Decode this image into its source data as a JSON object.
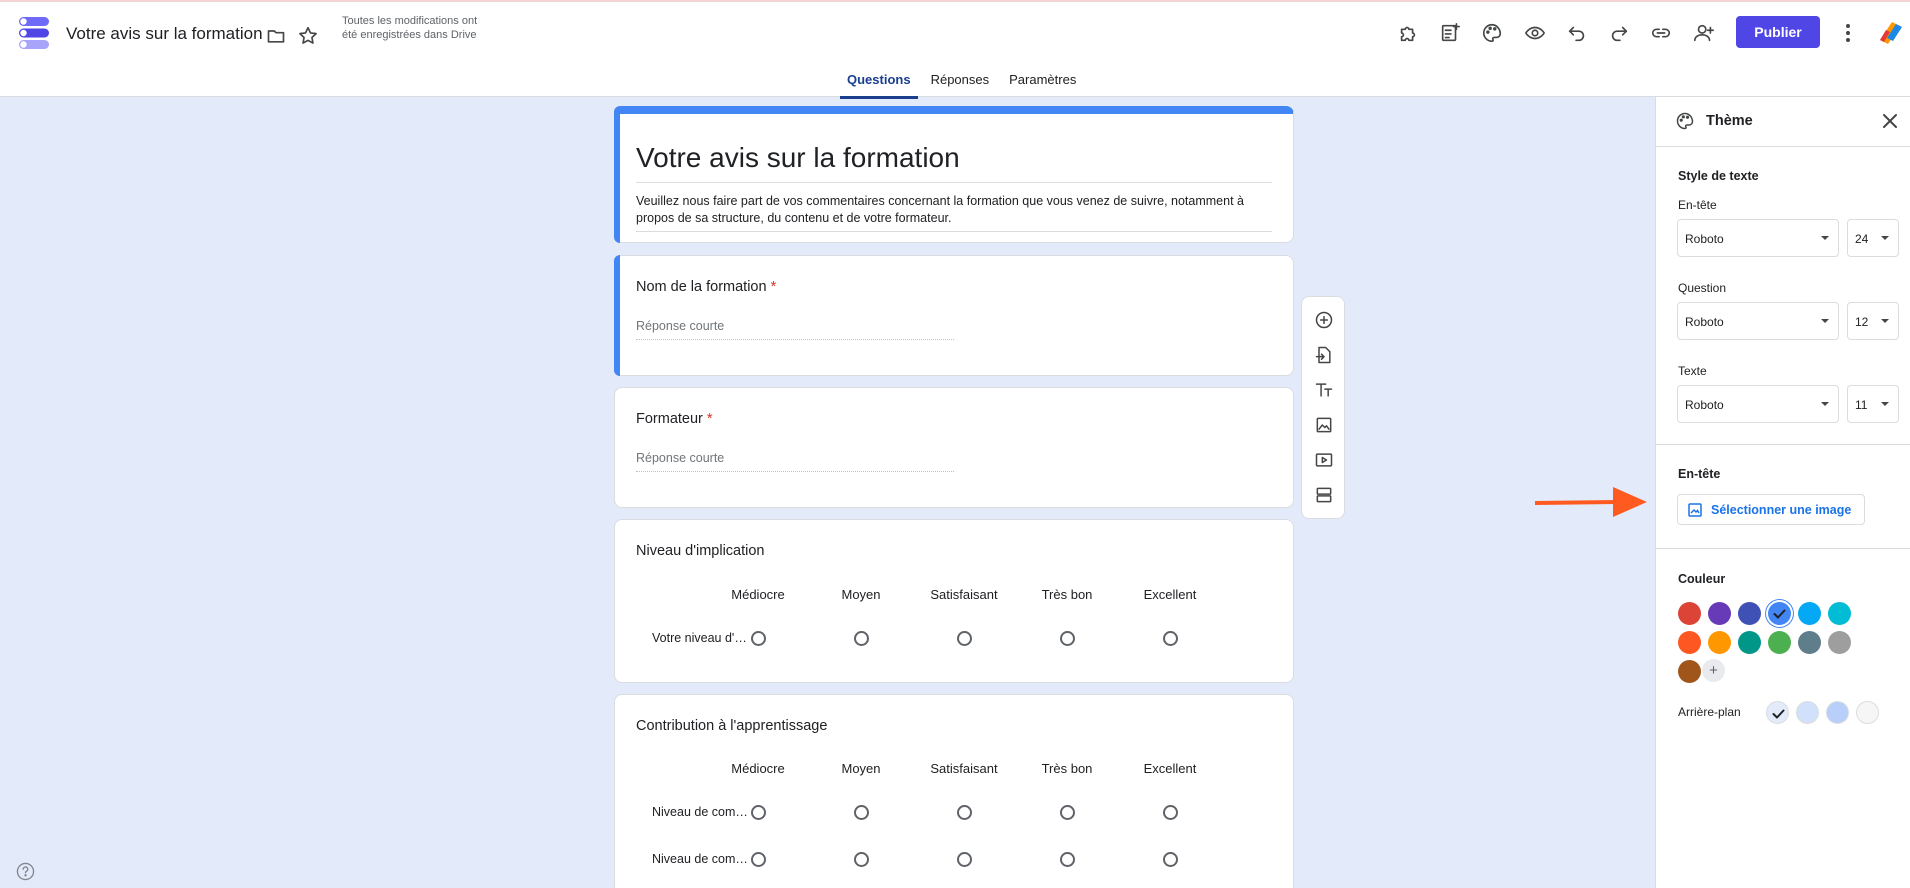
{
  "header": {
    "doc_title": "Votre avis sur la formation",
    "save_status": "Toutes les modifications ont été enregistrées dans Drive",
    "publish_label": "Publier",
    "tools": [
      "puzzle-icon",
      "add-sheet-icon",
      "palette-icon",
      "eye-icon",
      "undo-icon",
      "redo-icon",
      "link-icon",
      "add-person-icon"
    ]
  },
  "tabs": [
    {
      "label": "Questions",
      "active": true
    },
    {
      "label": "Réponses",
      "active": false
    },
    {
      "label": "Paramètres",
      "active": false
    }
  ],
  "form": {
    "title": "Votre avis sur la formation",
    "description": "Veuillez nous faire part de vos commentaires concernant la formation que vous venez de suivre, notamment à propos de sa structure, du contenu et de votre formateur."
  },
  "questions": [
    {
      "title": "Nom de la formation",
      "required": "*",
      "placeholder": "Réponse courte"
    },
    {
      "title": "Formateur",
      "required": "*",
      "placeholder": "Réponse courte"
    },
    {
      "title": "Niveau d'implication",
      "columns": [
        "Médiocre",
        "Moyen",
        "Satisfaisant",
        "Très bon",
        "Excellent"
      ],
      "rows": [
        "Votre niveau d'implication"
      ]
    },
    {
      "title": "Contribution à l'apprentissage",
      "columns": [
        "Médiocre",
        "Moyen",
        "Satisfaisant",
        "Très bon",
        "Excellent"
      ],
      "rows": [
        "Niveau de compétence avant",
        "Niveau de compétence après"
      ]
    }
  ],
  "side_toolbar": [
    "add-question-icon",
    "import-questions-icon",
    "title-text-icon",
    "image-icon",
    "video-icon",
    "section-icon"
  ],
  "theme_panel": {
    "title": "Thème",
    "text_style_label": "Style de texte",
    "header_label": "En-tête",
    "header_font": "Roboto",
    "header_size": "24",
    "question_label": "Question",
    "question_font": "Roboto",
    "question_size": "12",
    "text_label": "Texte",
    "text_font": "Roboto",
    "text_size": "11",
    "header_section_label": "En-tête",
    "select_image_label": "Sélectionner une image",
    "color_label": "Couleur",
    "colors": [
      "#db4437",
      "#673ab7",
      "#3f51b5",
      "#4285f4",
      "#03a9f4",
      "#00bcd4",
      "#ff5722",
      "#ff9800",
      "#009688",
      "#4caf50",
      "#607d8b",
      "#9e9e9e",
      "#a0561a"
    ],
    "selected_color": "#4285f4",
    "background_label": "Arrière-plan",
    "backgrounds": [
      "#e3ebfa",
      "#d2e1fb",
      "#b8cff9",
      "#f6f6f6"
    ],
    "selected_background": "#e3ebfa"
  },
  "annotation_color": "#ff5a1f"
}
